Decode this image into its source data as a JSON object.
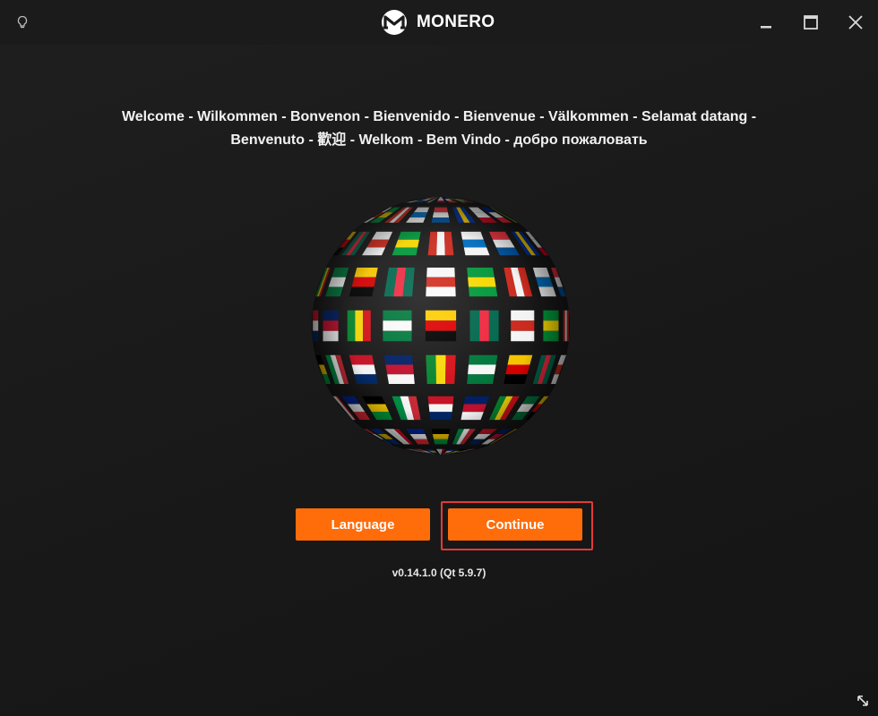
{
  "titlebar": {
    "app_name": "MONERO",
    "left_icon": "lightbulb-icon",
    "logo_icon": "monero-logo-icon",
    "controls": [
      "minimize-icon",
      "maximize-icon",
      "close-icon"
    ]
  },
  "welcome": {
    "line1": "Welcome - Wilkommen - Bonvenon - Bienvenido - Bienvenue - Välkommen - Selamat datang -",
    "line2": "Benvenuto - 歡迎 - Welkom - Bem Vindo - добро пожаловать"
  },
  "globe": {
    "icon": "world-flags-globe"
  },
  "buttons": {
    "language_label": "Language",
    "continue_label": "Continue"
  },
  "version": "v0.14.1.0 (Qt 5.9.7)",
  "resize_icon": "resize-diagonal-icon",
  "colors": {
    "accent": "#ff6c0a",
    "background": "#1e1e1e",
    "focus_outline": "#e23a3a"
  }
}
